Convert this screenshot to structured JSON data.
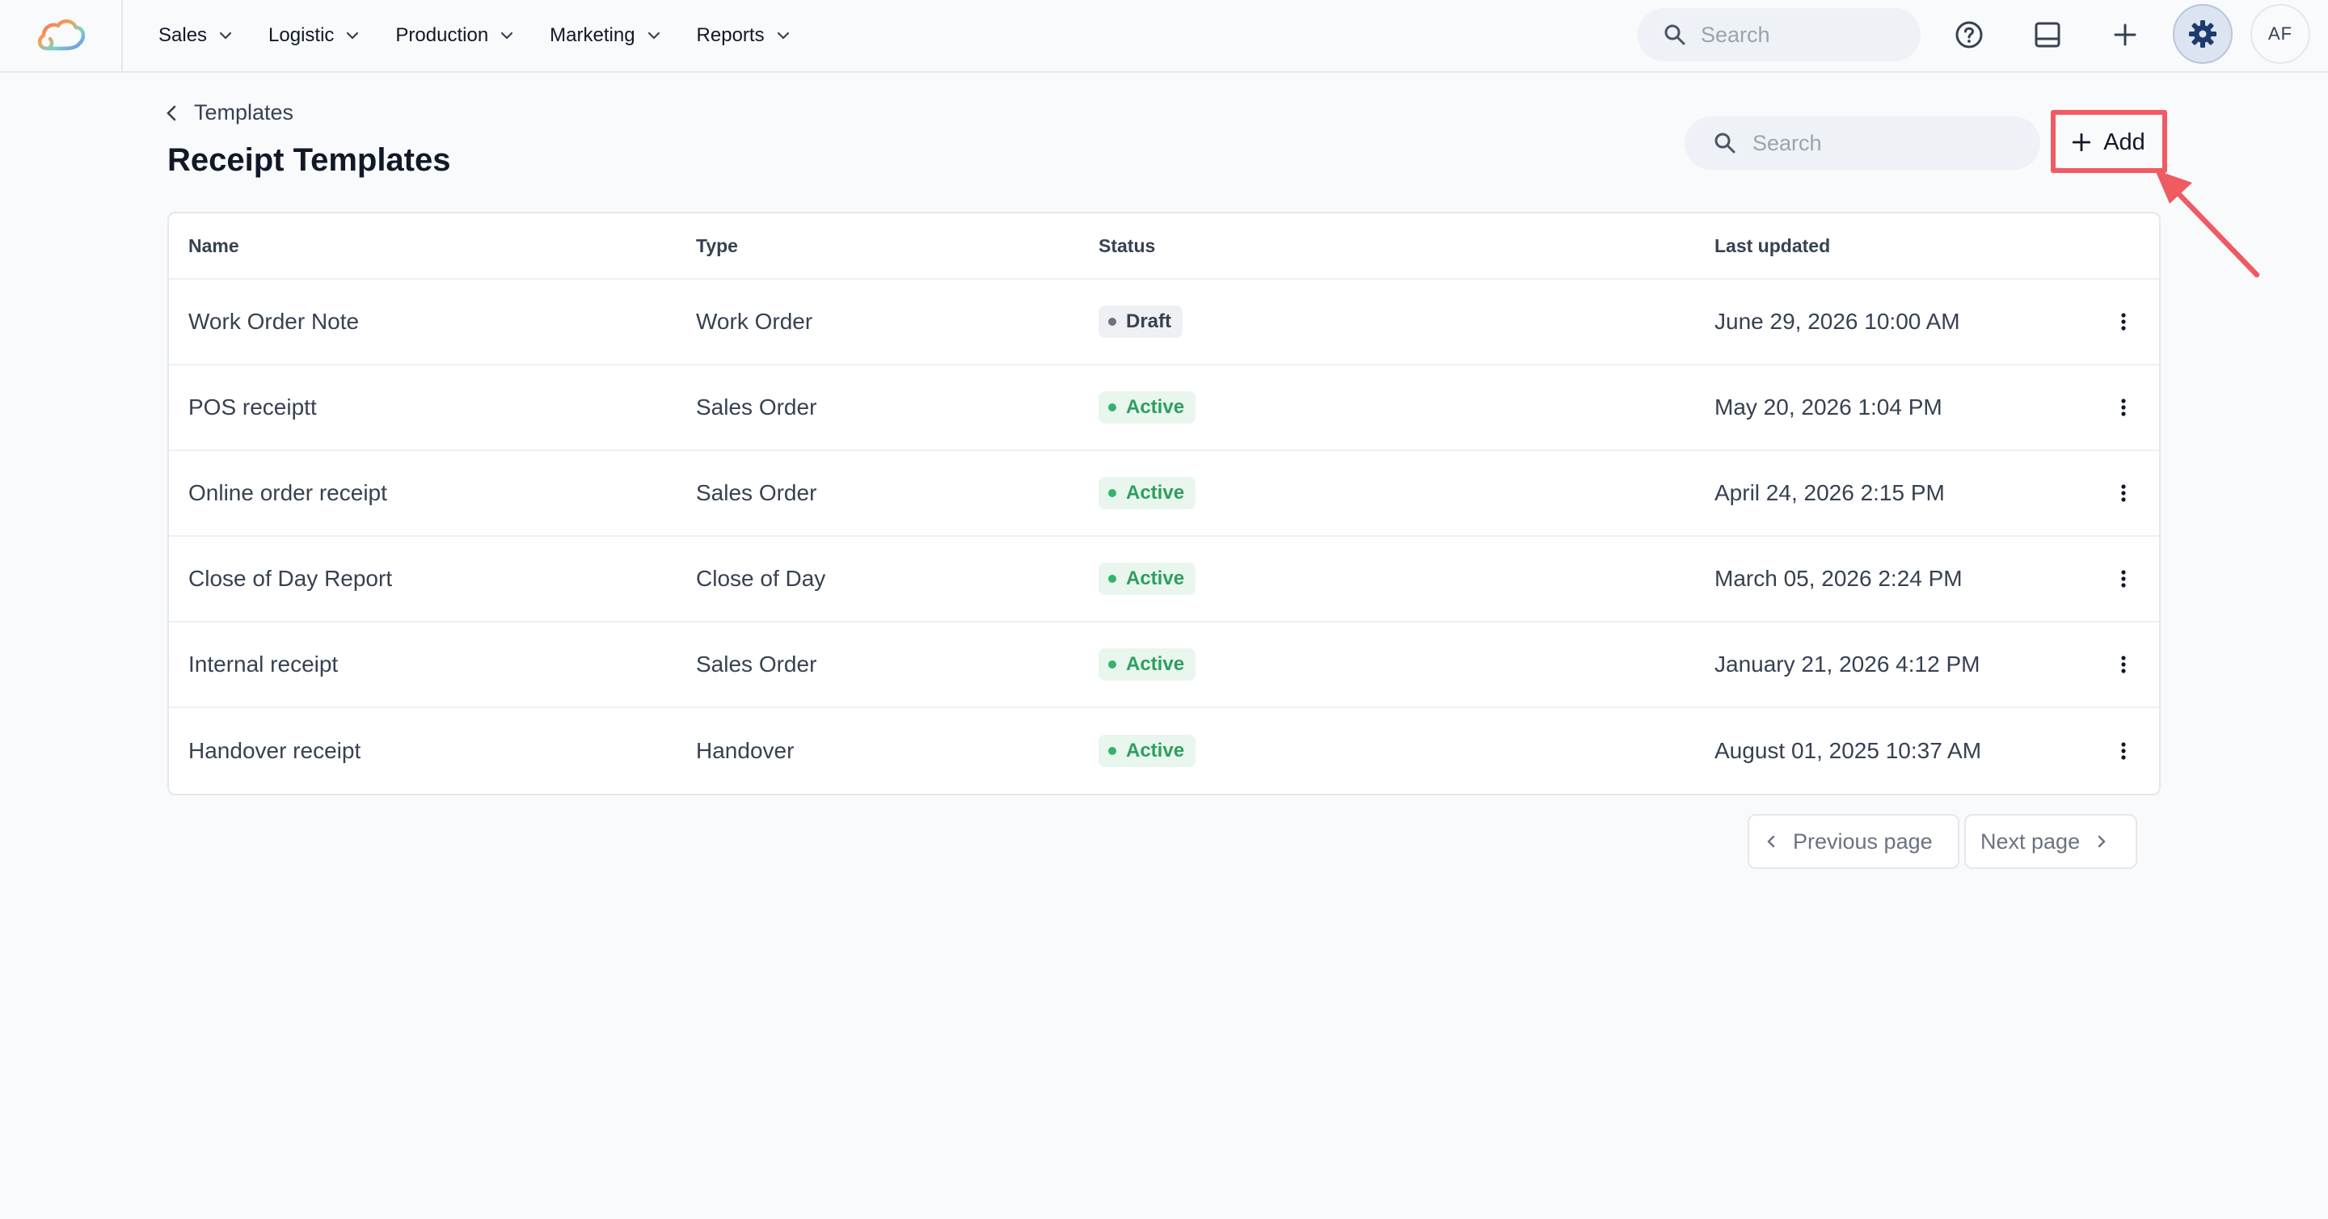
{
  "topnav": {
    "items": [
      {
        "label": "Sales"
      },
      {
        "label": "Logistic"
      },
      {
        "label": "Production"
      },
      {
        "label": "Marketing"
      },
      {
        "label": "Reports"
      }
    ],
    "search_placeholder": "Search",
    "avatar_initials": "AF",
    "icons": [
      "cloud-logo",
      "help-circle-icon",
      "inbox-icon",
      "plus-icon",
      "gear-icon"
    ]
  },
  "header": {
    "breadcrumb": "Templates",
    "title": "Receipt Templates",
    "search_placeholder": "Search",
    "add_label": "Add"
  },
  "table": {
    "columns": [
      "Name",
      "Type",
      "Status",
      "Last updated"
    ],
    "rows": [
      {
        "name": "Work Order Note",
        "type": "Work Order",
        "status": "Draft",
        "updated": "June 29, 2026 10:00 AM"
      },
      {
        "name": "POS receiptt",
        "type": "Sales Order",
        "status": "Active",
        "updated": "May 20, 2026 1:04 PM"
      },
      {
        "name": "Online order receipt",
        "type": "Sales Order",
        "status": "Active",
        "updated": "April 24, 2026 2:15 PM"
      },
      {
        "name": "Close of Day Report",
        "type": "Close of Day",
        "status": "Active",
        "updated": "March 05, 2026 2:24 PM"
      },
      {
        "name": "Internal receipt",
        "type": "Sales Order",
        "status": "Active",
        "updated": "January 21, 2026 4:12 PM"
      },
      {
        "name": "Handover receipt",
        "type": "Handover",
        "status": "Active",
        "updated": "August 01, 2025 10:37 AM"
      }
    ]
  },
  "pagination": {
    "prev_label": "Previous page",
    "next_label": "Next page"
  },
  "colors": {
    "highlight": "#ef5a63",
    "active_badge": "#2f9e5e",
    "draft_badge": "#374151",
    "gear_accent": "#1e3a6e"
  }
}
